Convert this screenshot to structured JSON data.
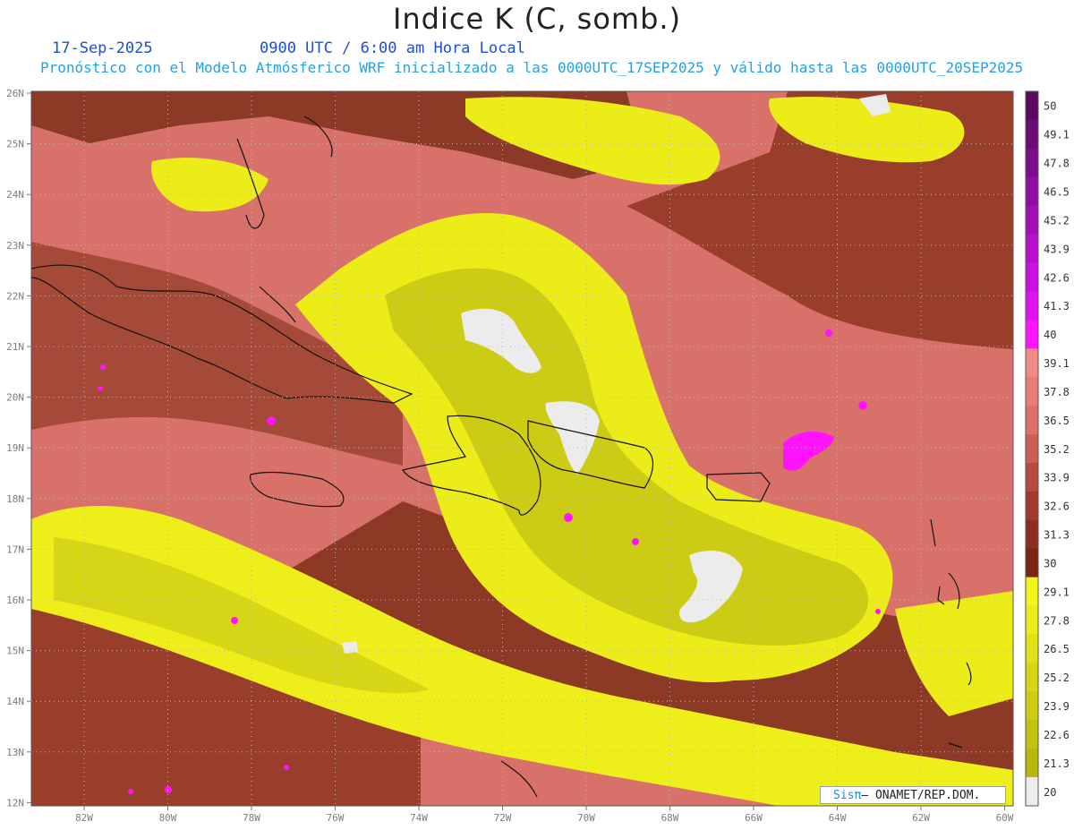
{
  "title": "Indice K (C, somb.)",
  "date_label": "17-Sep-2025",
  "time_label": "0900 UTC / 6:00 am Hora Local",
  "description": "Pronóstico con el Modelo Atmósferico WRF inicializado a las 0000UTC_17SEP2025 y válido hasta las  0000UTC_20SEP2025",
  "credit": {
    "logo": "Sisπ",
    "text": "– ONAMET/REP.DOM."
  },
  "map": {
    "lat_ticks": [
      "26N",
      "25N",
      "24N",
      "23N",
      "22N",
      "21N",
      "20N",
      "19N",
      "18N",
      "17N",
      "16N",
      "15N",
      "14N",
      "13N",
      "12N"
    ],
    "lon_ticks": [
      "82W",
      "80W",
      "78W",
      "76W",
      "74W",
      "72W",
      "70W",
      "68W",
      "66W",
      "64W",
      "62W",
      "60W"
    ],
    "gridlines": true,
    "coastlines": true
  },
  "colorbar": {
    "labels": [
      "50",
      "49.1",
      "47.8",
      "46.5",
      "45.2",
      "43.9",
      "42.6",
      "41.3",
      "40",
      "39.1",
      "37.8",
      "36.5",
      "35.2",
      "33.9",
      "32.6",
      "31.3",
      "30",
      "29.1",
      "27.8",
      "26.5",
      "25.2",
      "23.9",
      "22.6",
      "21.3",
      "20"
    ],
    "colors": [
      "#5a0a5e",
      "#6b0b75",
      "#7d0c8c",
      "#8f0da3",
      "#a30eb9",
      "#b80fcf",
      "#cc10e3",
      "#e012f2",
      "#ff14ff",
      "#f08c86",
      "#e87d78",
      "#df6f6a",
      "#cf5f55",
      "#b84a3f",
      "#a23a2e",
      "#8c2e22",
      "#7a2414",
      "#f5f51e",
      "#ebeb18",
      "#e0e016",
      "#d6d614",
      "#cccc12",
      "#c2c210",
      "#b8b80f",
      "#ececec"
    ]
  }
}
